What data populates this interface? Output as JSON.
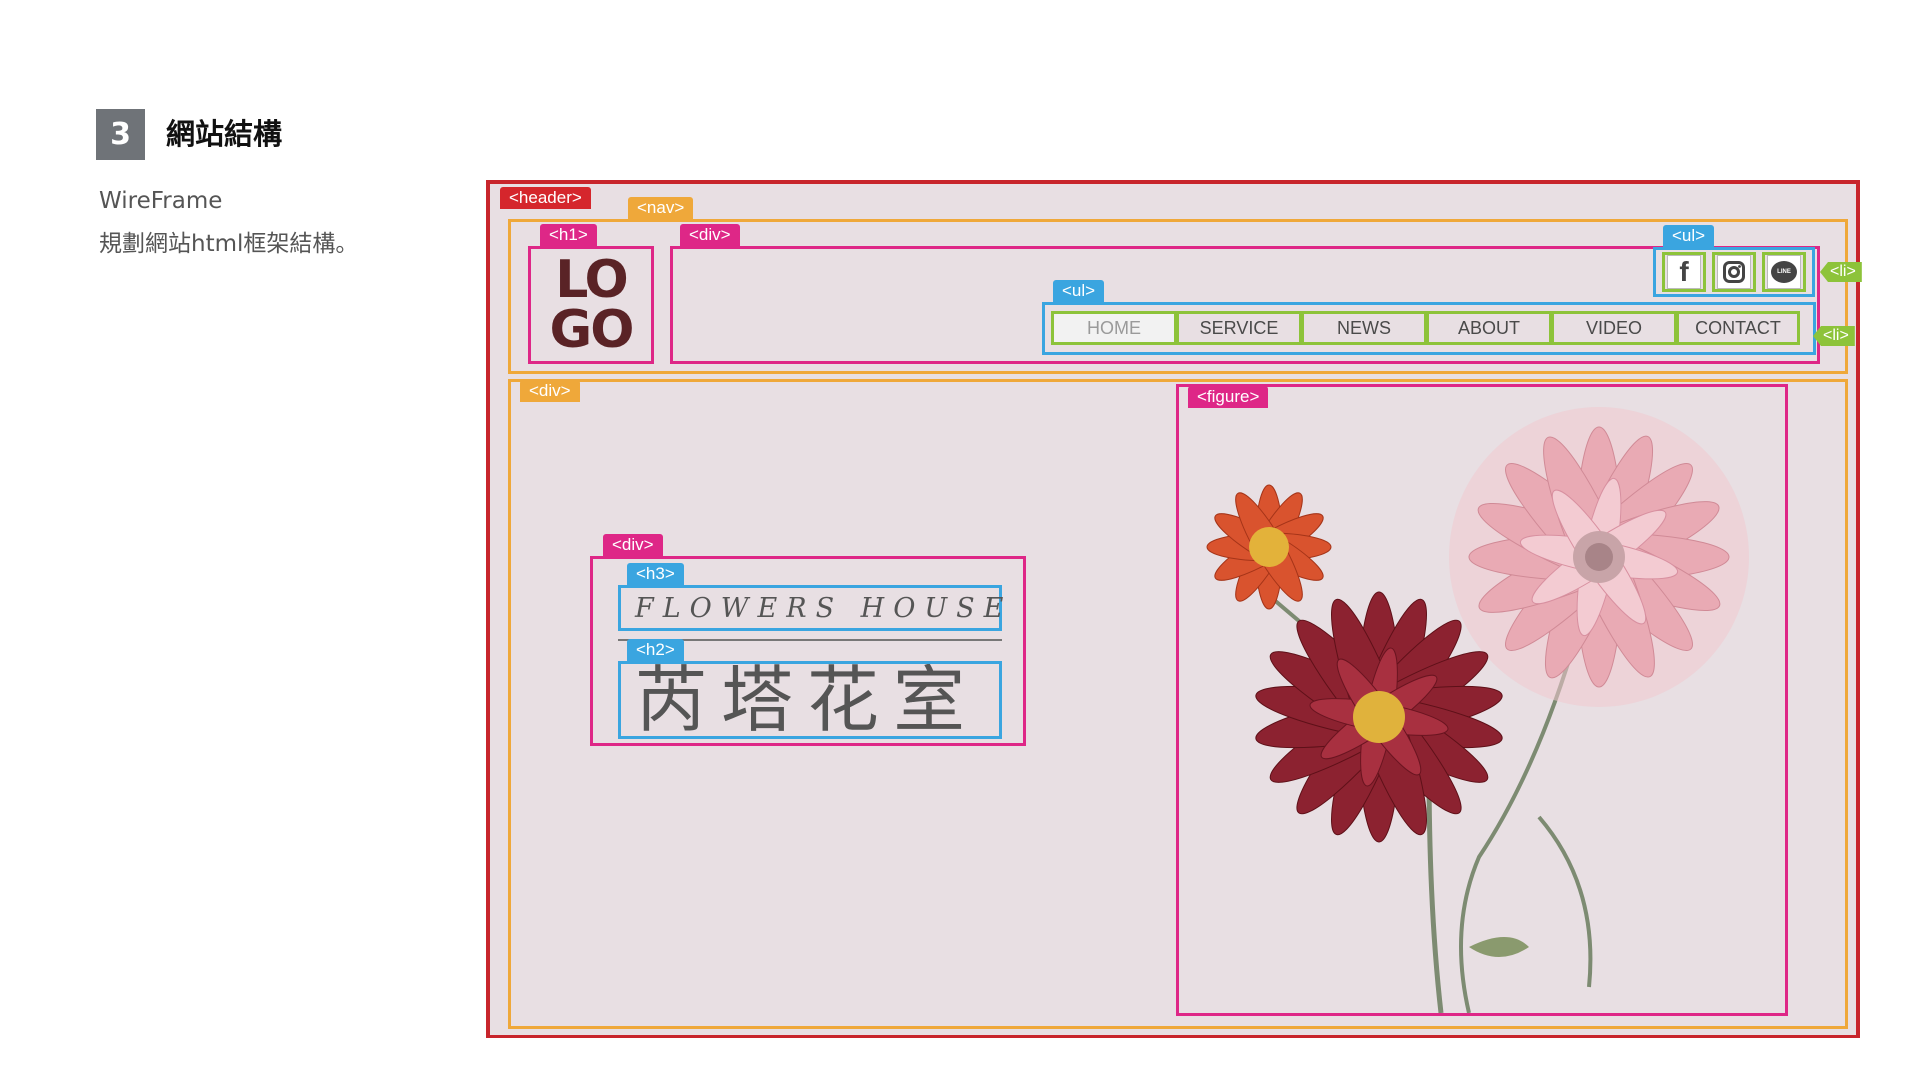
{
  "section": {
    "number": "3",
    "title": "網站結構",
    "subtitle": "WireFrame",
    "description": "規劃網站html框架結構。"
  },
  "tags": {
    "header": "<header>",
    "nav": "<nav>",
    "h1": "<h1>",
    "div_top": "<div>",
    "ul_social": "<ul>",
    "ul_nav": "<ul>",
    "li_social": "<li>",
    "li_nav": "<li>",
    "div_main": "<div>",
    "figure": "<figure>",
    "div_text": "<div>",
    "h3": "<h3>",
    "h2": "<h2>"
  },
  "logo": {
    "line1": "LO",
    "line2": "GO"
  },
  "social": [
    {
      "icon": "facebook-icon",
      "glyph": "f"
    },
    {
      "icon": "instagram-icon",
      "glyph": ""
    },
    {
      "icon": "line-icon",
      "glyph": "LINE"
    }
  ],
  "nav_items": [
    "HOME",
    "SERVICE",
    "NEWS",
    "ABOUT",
    "VIDEO",
    "CONTACT"
  ],
  "hero": {
    "h3": "FLOWERS HOUSE",
    "h2": "芮塔花室"
  },
  "colors": {
    "header": "#d5262c",
    "nav": "#efa83a",
    "pink": "#de2787",
    "blue": "#3aa5e0",
    "green": "#8dc33a",
    "canvas": "#e8dfe3"
  }
}
